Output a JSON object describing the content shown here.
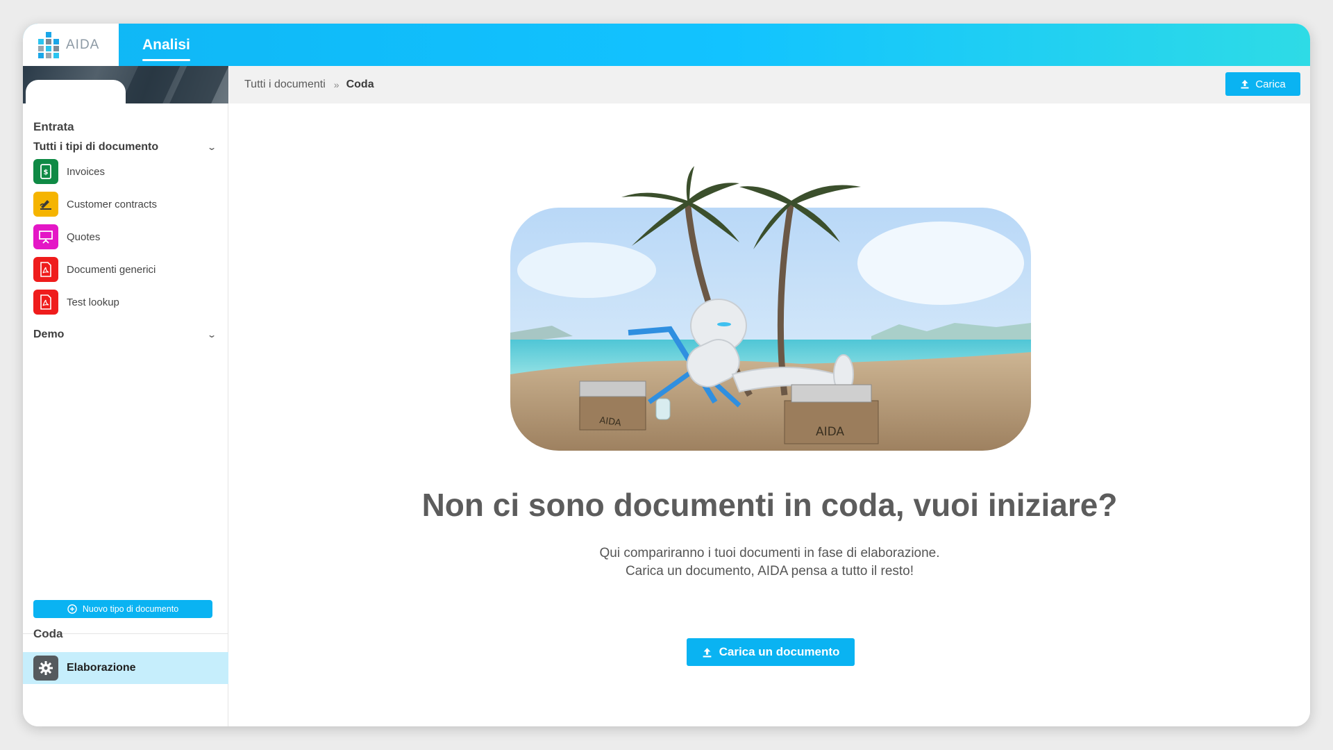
{
  "header": {
    "logo_text": "AIDA",
    "active_tab": "Analisi"
  },
  "sidebar": {
    "section_entrata": "Entrata",
    "group_all": "Tutti i tipi di documento",
    "items": [
      {
        "label": "Invoices",
        "icon": "invoice-icon",
        "color": "#0f8a45"
      },
      {
        "label": "Customer contracts",
        "icon": "signature-icon",
        "color": "#f5b400"
      },
      {
        "label": "Quotes",
        "icon": "presentation-icon",
        "color": "#e417c6"
      },
      {
        "label": "Documenti generici",
        "icon": "pdf-icon",
        "color": "#ef1c1c"
      },
      {
        "label": "Test lookup",
        "icon": "pdf-icon",
        "color": "#ef1c1c"
      }
    ],
    "group_demo": "Demo",
    "new_type_button": "Nuovo tipo di documento",
    "section_coda": "Coda",
    "elaborazione": "Elaborazione"
  },
  "breadcrumb": {
    "root": "Tutti i documenti",
    "separator": "»",
    "current": "Coda"
  },
  "toolbar": {
    "upload_label": "Carica"
  },
  "empty_state": {
    "title": "Non ci sono documenti in coda, vuoi iniziare?",
    "line1": "Qui compariranno i tuoi documenti in fase di elaborazione.",
    "line2": "Carica un documento, AIDA pensa a tutto il resto!",
    "cta": "Carica un documento",
    "box_label_left": "AIDA",
    "box_label_right": "AIDA"
  },
  "colors": {
    "accent": "#0ab3f2",
    "selected_bg": "#c6eefc"
  }
}
